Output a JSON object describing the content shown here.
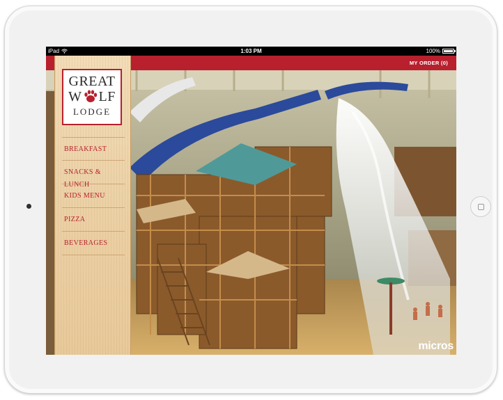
{
  "status_bar": {
    "device": "iPad",
    "time": "1:03 PM",
    "battery": "100%"
  },
  "header": {
    "order_label": "MY ORDER (0)"
  },
  "logo": {
    "line1": "GREAT",
    "line2_left": "W",
    "line2_right": "LF",
    "line3": "LODGE"
  },
  "menu": {
    "items": [
      {
        "label": "BREAKFAST"
      },
      {
        "label": "SNACKS & LUNCH"
      },
      {
        "label": "KIDS MENU"
      },
      {
        "label": "PIZZA"
      },
      {
        "label": "BEVERAGES"
      }
    ]
  },
  "brand": {
    "watermark": "micros"
  },
  "colors": {
    "accent_red": "#b8202e",
    "sidebar_wood": "#ecd1a6",
    "bezel": "#f1f1f1"
  },
  "icons": [
    "wifi-icon",
    "battery-icon",
    "paw-icon",
    "home-button-icon"
  ]
}
